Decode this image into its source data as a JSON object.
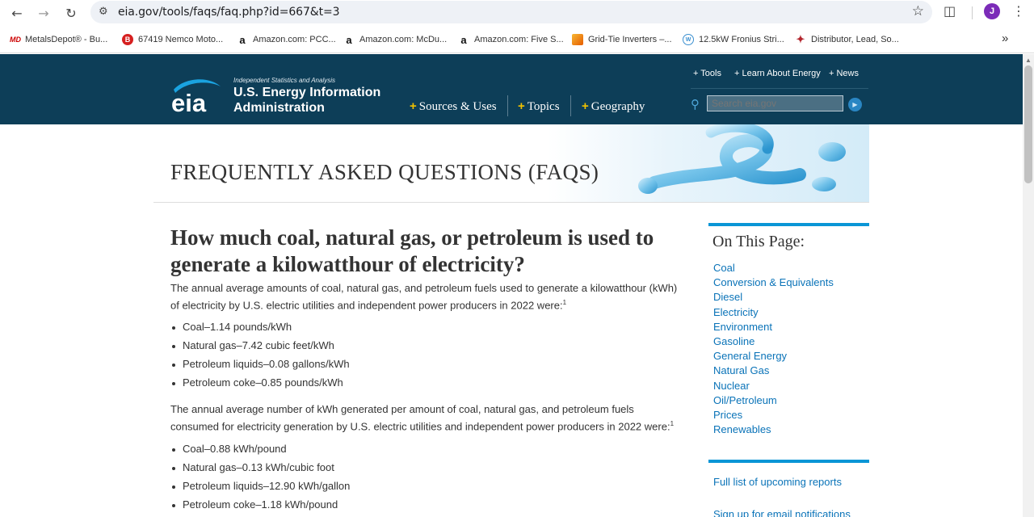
{
  "browser": {
    "url": "eia.gov/tools/faqs/faq.php?id=667&t=3",
    "avatar_letter": "J",
    "bookmarks": [
      {
        "label": "MetalsDepot® - Bu...",
        "icon": "MD"
      },
      {
        "label": "67419 Nemco Moto...",
        "icon": "B"
      },
      {
        "label": "Amazon.com: PCC...",
        "icon": "a"
      },
      {
        "label": "Amazon.com: McDu...",
        "icon": "a"
      },
      {
        "label": "Amazon.com: Five S...",
        "icon": "a"
      },
      {
        "label": "Grid-Tie Inverters –...",
        "icon": "grid-tie-icon"
      },
      {
        "label": "12.5kW Fronius Stri...",
        "icon": "fronius-icon"
      },
      {
        "label": "Distributor, Lead, So...",
        "icon": "distributor-icon"
      }
    ]
  },
  "header": {
    "logo_text": "eia",
    "tagline": "Independent Statistics and Analysis",
    "org_name_line1": "U.S. Energy Information",
    "org_name_line2": "Administration",
    "main_nav": [
      "Sources & Uses",
      "Topics",
      "Geography"
    ],
    "top_links": [
      "Tools",
      "Learn About Energy",
      "News"
    ],
    "search_placeholder": "Search eia.gov"
  },
  "banner": {
    "title": "FREQUENTLY ASKED QUESTIONS (FAQS)"
  },
  "article": {
    "question": "How much coal, natural gas, or petroleum is used to generate a kilowatthour of electricity?",
    "intro1": "The annual average amounts of coal, natural gas, and petroleum fuels used to generate a kilowatthour (kWh) of electricity by U.S. electric utilities and independent power producers in 2022 were:",
    "footnote": "1",
    "list1": [
      "Coal–1.14 pounds/kWh",
      "Natural gas–7.42 cubic feet/kWh",
      "Petroleum liquids–0.08 gallons/kWh",
      "Petroleum coke–0.85 pounds/kWh"
    ],
    "intro2": "The annual average number of kWh generated per amount of coal, natural gas, and petroleum fuels consumed for electricity generation by U.S. electric utilities and independent power producers in 2022 were:",
    "list2": [
      "Coal–0.88 kWh/pound",
      "Natural gas–0.13 kWh/cubic foot",
      "Petroleum liquids–12.90 kWh/gallon",
      "Petroleum coke–1.18 kWh/pound"
    ]
  },
  "sidebar": {
    "title": "On This Page:",
    "links": [
      "Coal",
      "Conversion & Equivalents",
      "Diesel",
      "Electricity",
      "Environment",
      "Gasoline",
      "General Energy",
      "Natural Gas",
      "Nuclear",
      "Oil/Petroleum",
      "Prices",
      "Renewables"
    ],
    "reports_link": "Full list of upcoming reports",
    "email_link": "Sign up for email notifications"
  },
  "colors": {
    "header_bg": "#0d3e58",
    "accent_blue": "#0a96d6",
    "link": "#0a73b8",
    "nav_plus": "#f2c200"
  }
}
